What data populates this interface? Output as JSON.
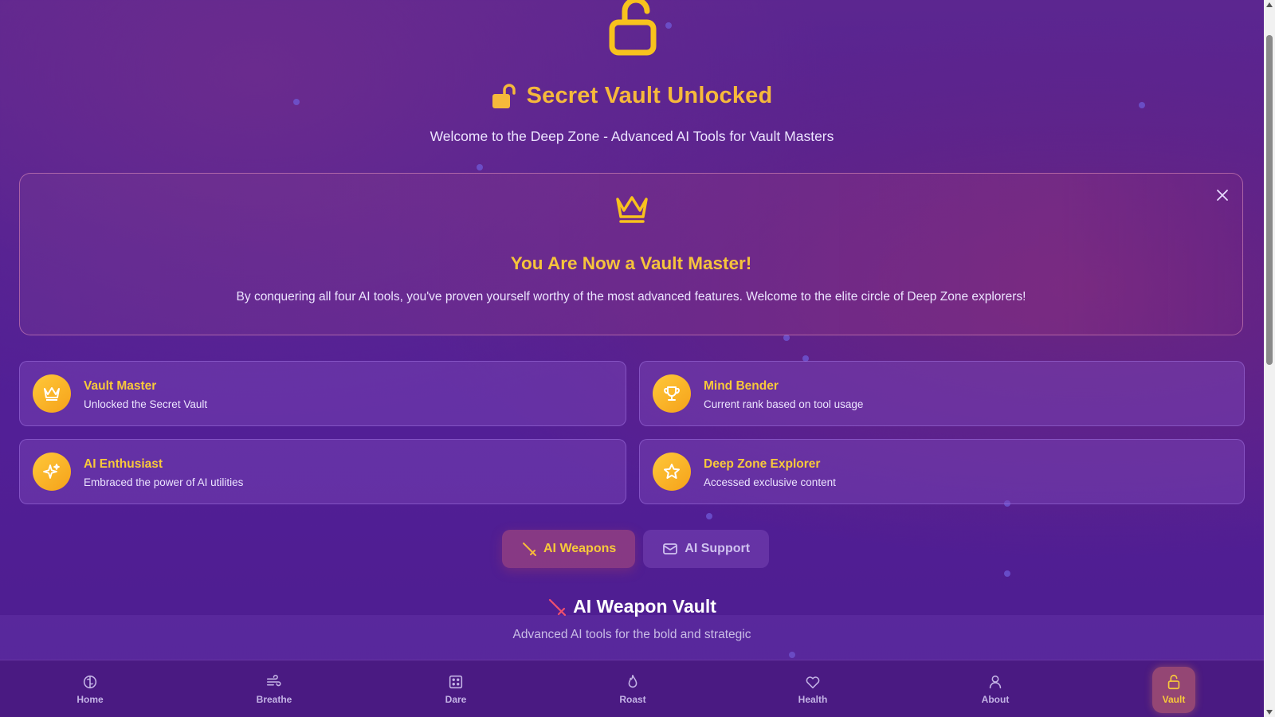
{
  "hero": {
    "title": "Secret Vault Unlocked",
    "subtitle": "Welcome to the Deep Zone - Advanced AI Tools for Vault Masters"
  },
  "banner": {
    "title": "You Are Now a Vault Master!",
    "text": "By conquering all four AI tools, you've proven yourself worthy of the most advanced features. Welcome to the elite circle of Deep Zone explorers!"
  },
  "badges": [
    {
      "title": "Vault Master",
      "desc": "Unlocked the Secret Vault",
      "icon": "crown-icon"
    },
    {
      "title": "Mind Bender",
      "desc": "Current rank based on tool usage",
      "icon": "trophy-icon"
    },
    {
      "title": "AI Enthusiast",
      "desc": "Embraced the power of AI utilities",
      "icon": "sparkles-icon"
    },
    {
      "title": "Deep Zone Explorer",
      "desc": "Accessed exclusive content",
      "icon": "star-icon"
    }
  ],
  "tabs": [
    {
      "label": "AI Weapons",
      "icon": "sword-icon",
      "active": true
    },
    {
      "label": "AI Support",
      "icon": "mail-icon",
      "active": false
    }
  ],
  "section": {
    "title": "AI Weapon Vault",
    "subtitle": "Advanced AI tools for the bold and strategic"
  },
  "nav": [
    {
      "label": "Home",
      "icon": "brain-icon"
    },
    {
      "label": "Breathe",
      "icon": "wind-icon"
    },
    {
      "label": "Dare",
      "icon": "dice-icon"
    },
    {
      "label": "Roast",
      "icon": "flame-icon"
    },
    {
      "label": "Health",
      "icon": "heart-icon"
    },
    {
      "label": "About",
      "icon": "user-icon"
    },
    {
      "label": "Vault",
      "icon": "lock-open-icon",
      "active": true
    }
  ],
  "colors": {
    "accent": "#f6b93b",
    "background": "#4f1f95",
    "nav_background": "#4a1a82"
  }
}
